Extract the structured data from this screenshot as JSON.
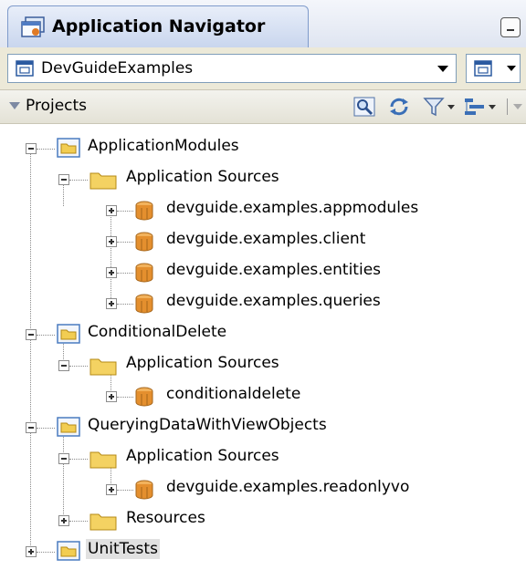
{
  "panel": {
    "title": "Application Navigator",
    "icons": {
      "tab": "application-navigator-icon",
      "minimize": "minimize-icon"
    }
  },
  "workspace": {
    "selected": "DevGuideExamples",
    "icons": {
      "app": "application-icon",
      "dropdown": "chevron-down-icon"
    }
  },
  "projects_header": {
    "label": "Projects",
    "toolbar_icons": [
      "find-icon",
      "sync-icon",
      "filter-icon",
      "sort-icon"
    ]
  },
  "tree": {
    "nodes": [
      {
        "label": "ApplicationModules",
        "type": "project",
        "expanded": true
      },
      {
        "label": "Application Sources",
        "type": "folder",
        "expanded": true
      },
      {
        "label": "devguide.examples.appmodules",
        "type": "package",
        "expanded": false
      },
      {
        "label": "devguide.examples.client",
        "type": "package",
        "expanded": false
      },
      {
        "label": "devguide.examples.entities",
        "type": "package",
        "expanded": false
      },
      {
        "label": "devguide.examples.queries",
        "type": "package",
        "expanded": false
      },
      {
        "label": "ConditionalDelete",
        "type": "project",
        "expanded": true
      },
      {
        "label": "Application Sources",
        "type": "folder",
        "expanded": true
      },
      {
        "label": "conditionaldelete",
        "type": "package",
        "expanded": false
      },
      {
        "label": "QueryingDataWithViewObjects",
        "type": "project",
        "expanded": true
      },
      {
        "label": "Application Sources",
        "type": "folder",
        "expanded": true
      },
      {
        "label": "devguide.examples.readonlyvo",
        "type": "package",
        "expanded": false
      },
      {
        "label": "Resources",
        "type": "folder",
        "expanded": false
      },
      {
        "label": "UnitTests",
        "type": "project",
        "expanded": false,
        "selected": true
      }
    ]
  }
}
